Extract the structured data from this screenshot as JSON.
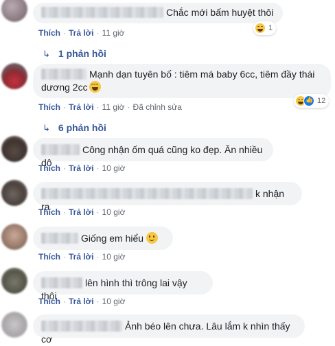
{
  "labels": {
    "like": "Thích",
    "reply": "Trả lời",
    "sep": "·",
    "edited": "Đã chỉnh sửa"
  },
  "comments": [
    {
      "text": "Chắc mới bấm huyệt thôi",
      "time": "11 giờ",
      "reaction_count": "1",
      "reactions": [
        "haha-icon"
      ]
    },
    {
      "text": "Mạnh dạn tuyên bố : tiêm má baby 6cc, tiêm đầy thái dương 2cc",
      "time": "11 giờ",
      "reaction_count": "12",
      "reactions": [
        "haha-icon",
        "like-icon"
      ]
    },
    {
      "text": "Công nhận ốm quá cũng ko đẹp. Ăn nhiều dô",
      "time": "10 giờ"
    },
    {
      "text": "k nhận ra",
      "time": "10 giờ"
    },
    {
      "text": "Giống em hiểu",
      "time": "10 giờ",
      "inline_emoji": "smile-icon"
    },
    {
      "text": "lên hình thì trông lai vậy thôi",
      "time": "10 giờ"
    },
    {
      "text": "Ảnh béo lên chưa. Lâu lắm k nhìn thấy cơ",
      "time": ""
    }
  ],
  "reply_links": [
    {
      "label": "1 phản hồi"
    },
    {
      "label": "6 phản hồi"
    }
  ],
  "colors": {
    "bubble": "#f2f3f5",
    "link": "#385898",
    "meta": "#606770"
  }
}
